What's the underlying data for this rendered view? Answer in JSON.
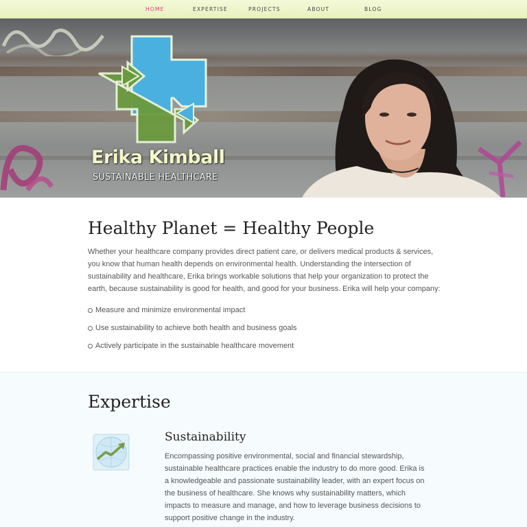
{
  "nav": {
    "items": [
      {
        "label": "HOME",
        "active": true
      },
      {
        "label": "EXPERTISE",
        "active": false
      },
      {
        "label": "PROJECTS",
        "active": false
      },
      {
        "label": "ABOUT",
        "active": false
      },
      {
        "label": "BLOG",
        "active": false
      }
    ]
  },
  "hero": {
    "name": "Erika Kimball",
    "subtitle": "SUSTAINABLE HEALTHCARE",
    "logo_icon": "medical-cross-arrows-icon"
  },
  "intro": {
    "heading": "Healthy Planet = Healthy People",
    "paragraph": "Whether your healthcare company provides direct patient care, or delivers medical products & services, you know that human health depends on environmental health. Understanding the intersection of sustainability and healthcare, Erika brings workable solutions that help your organization to protect the earth, because sustainability is good for health, and good for your business. Erika will help your company:",
    "bullets": [
      "Measure and minimize environmental impact",
      "Use sustainability to achieve both health and business goals",
      "Actively participate in the sustainable healthcare movement"
    ]
  },
  "expertise": {
    "heading": "Expertise",
    "items": [
      {
        "title": "Sustainability",
        "icon": "globe-chart-icon",
        "paragraph": "Encompassing positive environmental, social and financial stewardship, sustainable healthcare practices enable the industry to do more good. Erika is a knowledgeable and passionate sustainability leader, with an expert focus on the business of healthcare. She knows why sustainability matters, which impacts to measure and manage, and how to leverage business decisions to support positive change in the industry."
      }
    ]
  },
  "colors": {
    "nav_bg": "#eef5cc",
    "nav_active": "#e0397a",
    "logo_green": "#6a9a3e",
    "logo_blue": "#4ab0e0",
    "name_color": "#f4f6c8"
  }
}
